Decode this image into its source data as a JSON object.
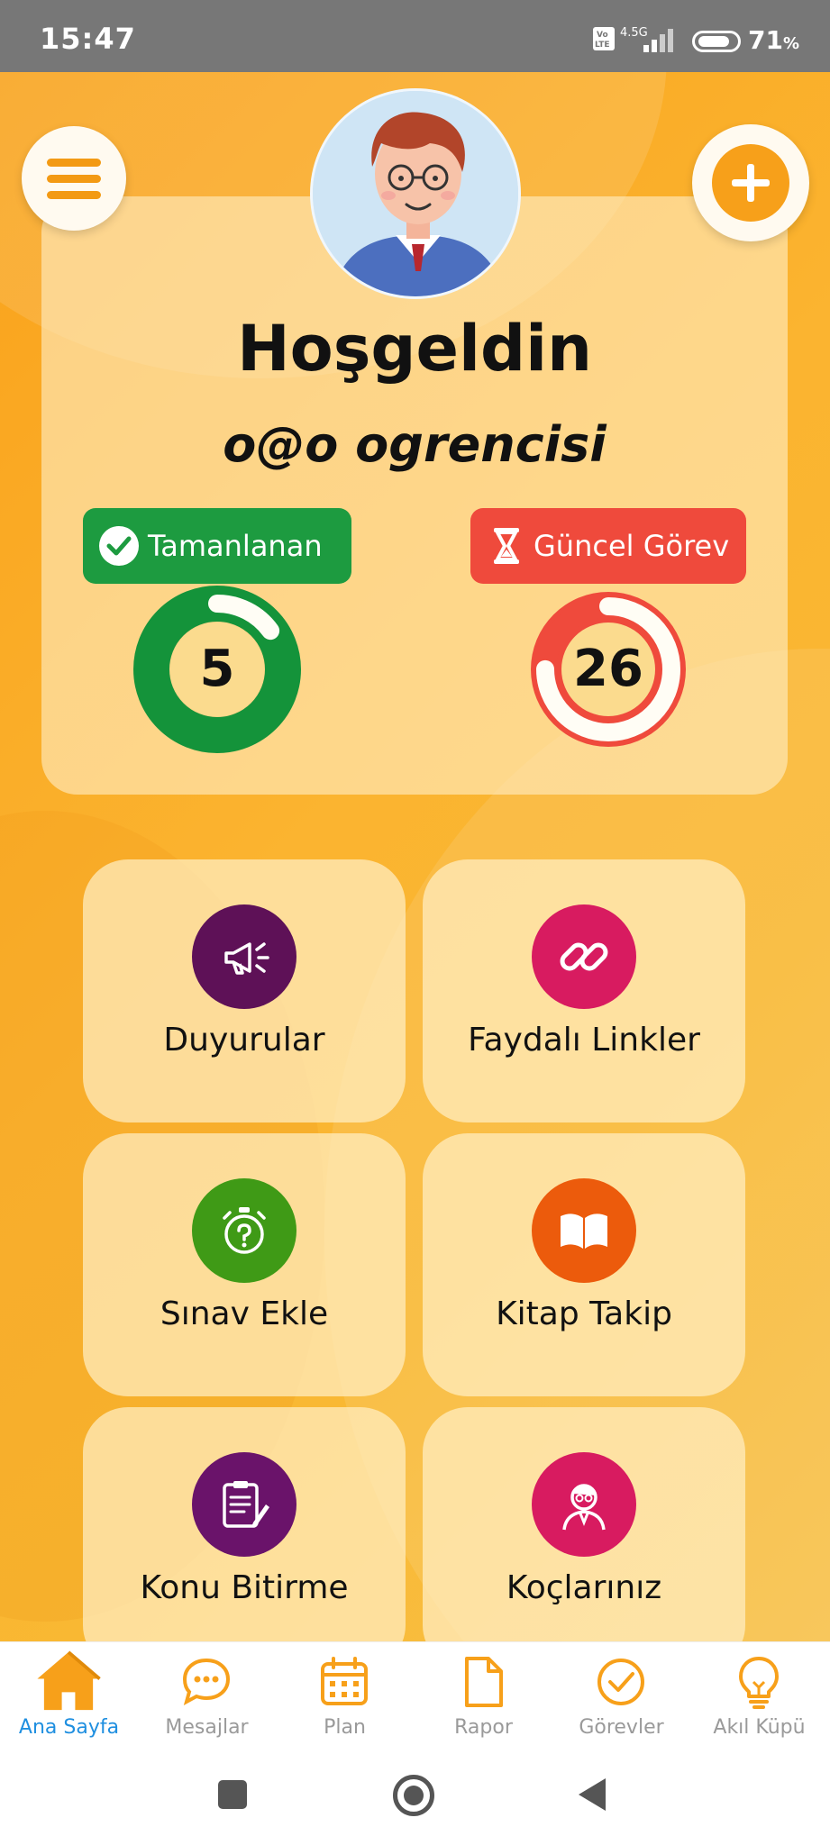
{
  "status_bar": {
    "time": "15:47",
    "network": "4.5G",
    "volte": "Vo LTE",
    "battery": "71",
    "battery_unit": "%"
  },
  "header": {
    "menu_icon": "hamburger-menu-icon",
    "add_icon": "plus-icon"
  },
  "profile": {
    "greeting": "Hoşgeldin",
    "username": "o@o ogrencisi",
    "completed": {
      "label": "Tamanlanan",
      "value": "5",
      "color": "#1d9b40",
      "progress": 0.15
    },
    "current": {
      "label": "Güncel Görev",
      "value": "26",
      "color": "#ef4a3c",
      "progress": 0.75
    }
  },
  "tiles": [
    {
      "label": "Duyurular",
      "icon": "megaphone-icon",
      "color": "#5e1157"
    },
    {
      "label": "Faydalı Linkler",
      "icon": "link-icon",
      "color": "#d81b60"
    },
    {
      "label": "Sınav Ekle",
      "icon": "stopwatch-icon",
      "color": "#3f9a16"
    },
    {
      "label": "Kitap Takip",
      "icon": "book-icon",
      "color": "#ec5b0c"
    },
    {
      "label": "Konu Bitirme",
      "icon": "clipboard-icon",
      "color": "#6a136a"
    },
    {
      "label": "Koçlarınız",
      "icon": "coach-icon",
      "color": "#d81b60"
    }
  ],
  "bottom_nav": [
    {
      "label": "Ana Sayfa",
      "icon": "home-icon",
      "active": true
    },
    {
      "label": "Mesajlar",
      "icon": "chat-icon",
      "active": false
    },
    {
      "label": "Plan",
      "icon": "calendar-icon",
      "active": false
    },
    {
      "label": "Rapor",
      "icon": "document-icon",
      "active": false
    },
    {
      "label": "Görevler",
      "icon": "check-circle-icon",
      "active": false
    },
    {
      "label": "Akıl Küpü",
      "icon": "lightbulb-icon",
      "active": false
    }
  ],
  "colors": {
    "accent": "#f7a01a",
    "nav_active": "#1f8fe0",
    "nav_inactive": "#9a9a9a"
  }
}
